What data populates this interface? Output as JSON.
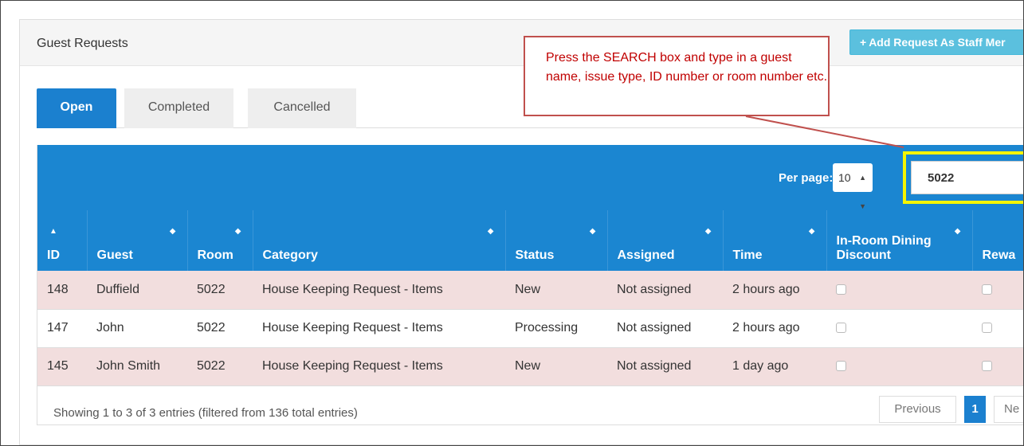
{
  "panel": {
    "title": "Guest Requests"
  },
  "add_button": {
    "label": "Add Request As Staff Mer"
  },
  "tabs": [
    {
      "label": "Open",
      "active": true
    },
    {
      "label": "Completed",
      "active": false
    },
    {
      "label": "Cancelled",
      "active": false
    }
  ],
  "toolbar": {
    "per_page_label": "Per page:",
    "per_page_value": "10",
    "search_value": "5022"
  },
  "columns": [
    {
      "label": "ID"
    },
    {
      "label": "Guest"
    },
    {
      "label": "Room"
    },
    {
      "label": "Category"
    },
    {
      "label": "Status"
    },
    {
      "label": "Assigned"
    },
    {
      "label": "Time"
    },
    {
      "label": "In-Room Dining Discount"
    },
    {
      "label": "Rewa"
    }
  ],
  "rows": [
    {
      "id": "148",
      "guest": "Duffield",
      "room": "5022",
      "category": "House Keeping Request - Items",
      "status": "New",
      "assigned": "Not assigned",
      "time": "2 hours ago"
    },
    {
      "id": "147",
      "guest": "John",
      "room": "5022",
      "category": "House Keeping Request - Items",
      "status": "Processing",
      "assigned": "Not assigned",
      "time": "2 hours ago"
    },
    {
      "id": "145",
      "guest": "John Smith",
      "room": "5022",
      "category": "House Keeping Request - Items",
      "status": "New",
      "assigned": "Not assigned",
      "time": "1 day ago"
    }
  ],
  "footer": {
    "info": "Showing 1 to 3 of 3 entries (filtered from 136 total entries)",
    "previous": "Previous",
    "page": "1",
    "next": "Ne"
  },
  "callout": {
    "text": "Press the SEARCH box and type in a guest name, issue type, ID number or room number etc."
  },
  "colors": {
    "header_blue": "#1b86d1",
    "tab_active": "#1b80cf",
    "row_highlight": "#f2dede",
    "add_button": "#5bc0de",
    "search_highlight": "#f5f500",
    "callout_border": "#c0504d",
    "callout_text": "#c00000"
  },
  "icons": {
    "add": "plus-icon",
    "sort": "sort-icon",
    "sort_asc": "sort-asc-icon",
    "select": "chevron-up-down-icon"
  }
}
